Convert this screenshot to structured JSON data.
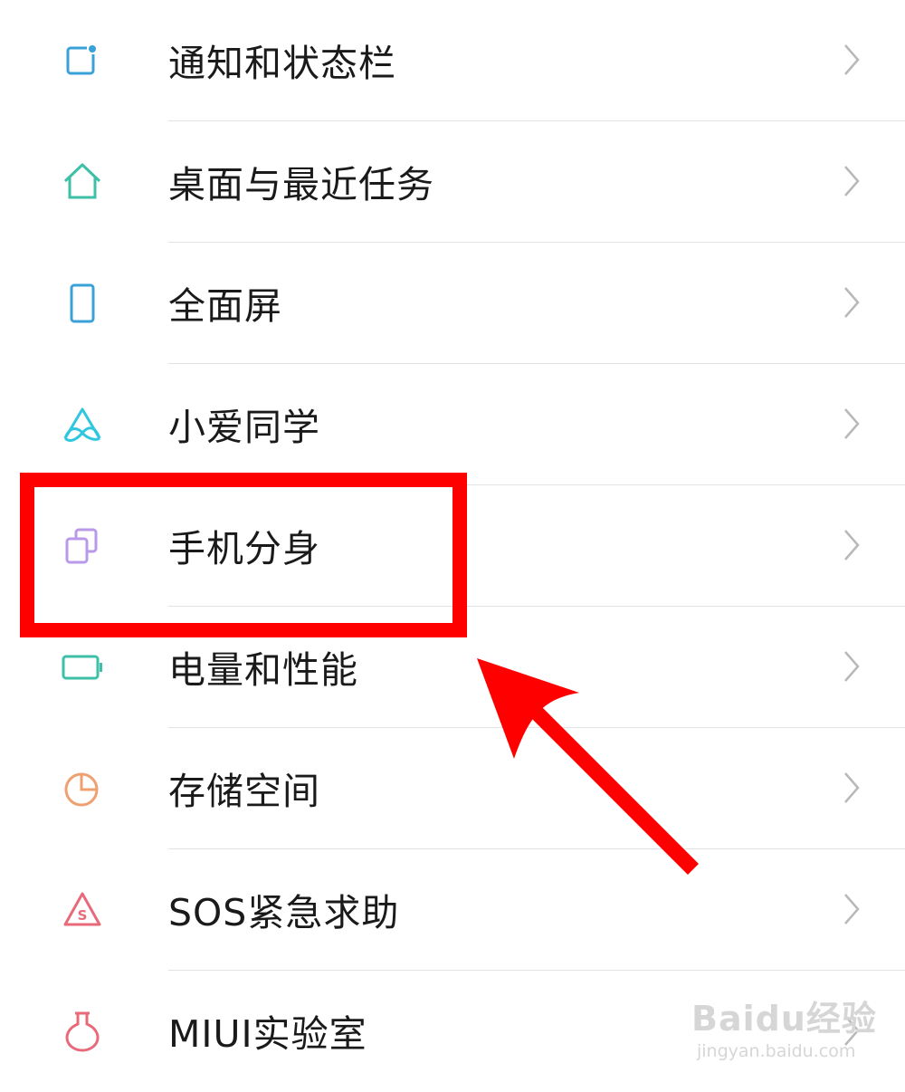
{
  "settings_list": {
    "items": [
      {
        "label": "通知和状态栏",
        "icon": "notification-icon",
        "color": "#3aa0d8"
      },
      {
        "label": "桌面与最近任务",
        "icon": "home-icon",
        "color": "#3dbfa8"
      },
      {
        "label": "全面屏",
        "icon": "phone-screen-icon",
        "color": "#3aa0d8"
      },
      {
        "label": "小爱同学",
        "icon": "xiaoai-icon",
        "color": "#2fc7e0"
      },
      {
        "label": "手机分身",
        "icon": "second-space-icon",
        "color": "#b99ae8"
      },
      {
        "label": "电量和性能",
        "icon": "battery-icon",
        "color": "#3dbfa8"
      },
      {
        "label": "存储空间",
        "icon": "storage-pie-icon",
        "color": "#f0a070"
      },
      {
        "label": "SOS紧急求助",
        "icon": "sos-icon",
        "color": "#e86a7a"
      },
      {
        "label": "MIUI实验室",
        "icon": "lab-flask-icon",
        "color": "#e86a7a"
      }
    ]
  },
  "annotation": {
    "highlight_color": "#ff0000",
    "highlighted_item": "手机分身"
  },
  "watermark": {
    "main": "Baidu经验",
    "sub": "jingyan.baidu.com"
  }
}
